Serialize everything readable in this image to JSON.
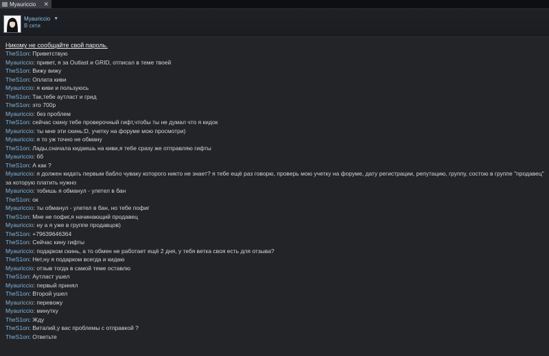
{
  "tab": {
    "title": "Myauriccio",
    "close_glyph": "✕",
    "icon": "steam-chat-icon"
  },
  "header": {
    "name": "Myauriccio",
    "status": "В сети",
    "caret": "▼",
    "avatar": "avatar-dark-hair"
  },
  "warning": "Никому не сообщайте свой пароль.",
  "messages": [
    {
      "sender": "TheS1on",
      "text": "Приветствую"
    },
    {
      "sender": "Myauriccio",
      "text": "привет, я за Outlast и GRID, отписал в теме твоей"
    },
    {
      "sender": "TheS1on",
      "text": "Вижу вижу"
    },
    {
      "sender": "TheS1on",
      "text": "Оплата киви"
    },
    {
      "sender": "Myauriccio",
      "text": "я киви и пользуюсь"
    },
    {
      "sender": "TheS1on",
      "text": "Так,тебе аутласт и грид"
    },
    {
      "sender": "TheS1on",
      "text": "это 700р"
    },
    {
      "sender": "Myauriccio",
      "text": "без проблем"
    },
    {
      "sender": "TheS1on",
      "text": "сейчас скину тебе проверочный гифт,чтобы ты не думал что я кидок"
    },
    {
      "sender": "Myauriccio",
      "text": "ты мне эти скинь:D, учетку на форуме мою просмотри)"
    },
    {
      "sender": "Myauriccio",
      "text": "я то уж точно не обману"
    },
    {
      "sender": "TheS1on",
      "text": "Лады,сначала кидаешь на киви,я тебе сразу же отправляю гифты"
    },
    {
      "sender": "Myauriccio",
      "text": "бб"
    },
    {
      "sender": "TheS1on",
      "text": "А как ?"
    },
    {
      "sender": "Myauriccio",
      "text": "я должен кидать первым бабло чуваку которого никто не знает? я тебе ещё раз говорю, проверь мою учетку на форуме, дату регистрации, репутацию, группу, состою в группе \"продавец\" за которую платить нужно"
    },
    {
      "sender": "Myauriccio",
      "text": "тобишь я обманул - улетел в бан"
    },
    {
      "sender": "TheS1on",
      "text": "ок"
    },
    {
      "sender": "Myauriccio",
      "text": "ты обманул - улетел в бан, но тебе пофиг"
    },
    {
      "sender": "TheS1on",
      "text": "Мне не пофиг,я начинающий продавец"
    },
    {
      "sender": "Myauriccio",
      "text": "ну а я уже в группе продавцов)"
    },
    {
      "sender": "TheS1on",
      "text": "+79639646364"
    },
    {
      "sender": "TheS1on",
      "text": "Сейчас кину гифты"
    },
    {
      "sender": "Myauriccio",
      "text": "подарком скинь, а то обмен не работает ещё 2 дня, у тебя ветка своя есть для отзыва?"
    },
    {
      "sender": "TheS1on",
      "text": "Нет,ну я подарком всегда и кидаю"
    },
    {
      "sender": "Myauriccio",
      "text": "отзыв тогда в самой теме оставлю"
    },
    {
      "sender": "TheS1on",
      "text": "Аутласт ушел"
    },
    {
      "sender": "Myauriccio",
      "text": "первый принял"
    },
    {
      "sender": "TheS1on",
      "text": "Второй ушел"
    },
    {
      "sender": "Myauriccio",
      "text": "перевожу"
    },
    {
      "sender": "Myauriccio",
      "text": "минутку"
    },
    {
      "sender": "TheS1on",
      "text": "Жду"
    },
    {
      "sender": "TheS1on",
      "text": "Виталий,у вас проблемы с отправкой ?"
    },
    {
      "sender": "TheS1on",
      "text": "Ответьте"
    }
  ]
}
